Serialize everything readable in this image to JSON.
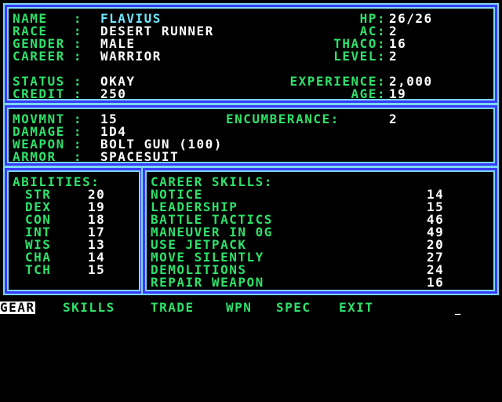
{
  "character": {
    "name_label": "NAME   :",
    "name": "FLAVIUS",
    "race_label": "RACE   :",
    "race": "DESERT RUNNER",
    "gender_label": "GENDER :",
    "gender": "MALE",
    "career_label": "CAREER :",
    "career": "WARRIOR",
    "status_label": "STATUS :",
    "status": "OKAY",
    "credit_label": "CREDIT :",
    "credit": "250",
    "hp_label": "HP:",
    "hp": "26/26",
    "ac_label": "AC:",
    "ac": "2",
    "thaco_label": "THACO:",
    "thaco": "16",
    "level_label": "LEVEL:",
    "level": "2",
    "experience_label": "EXPERIENCE:",
    "experience": "2,000",
    "age_label": "AGE:",
    "age": "19"
  },
  "equipment": {
    "movement_label": "MOVMNT :",
    "movement": "15",
    "damage_label": "DAMAGE :",
    "damage": "1D4",
    "weapon_label": "WEAPON :",
    "weapon": "BOLT GUN (100)",
    "armor_label": "ARMOR  :",
    "armor": "SPACESUIT",
    "encumberance_label": "ENCUMBERANCE:",
    "encumberance": "2"
  },
  "abilities": {
    "header": "ABILITIES:",
    "items": [
      {
        "name": "STR",
        "value": "20"
      },
      {
        "name": "DEX",
        "value": "19"
      },
      {
        "name": "CON",
        "value": "18"
      },
      {
        "name": "INT",
        "value": "17"
      },
      {
        "name": "WIS",
        "value": "13"
      },
      {
        "name": "CHA",
        "value": "14"
      },
      {
        "name": "TCH",
        "value": "15"
      }
    ]
  },
  "skills": {
    "header": "CAREER SKILLS:",
    "items": [
      {
        "name": "NOTICE",
        "value": "14"
      },
      {
        "name": "LEADERSHIP",
        "value": "15"
      },
      {
        "name": "BATTLE TACTICS",
        "value": "46"
      },
      {
        "name": "MANEUVER IN 0G",
        "value": "49"
      },
      {
        "name": "USE JETPACK",
        "value": "20"
      },
      {
        "name": "MOVE SILENTLY",
        "value": "27"
      },
      {
        "name": "DEMOLITIONS",
        "value": "24"
      },
      {
        "name": "REPAIR WEAPON",
        "value": "16"
      }
    ]
  },
  "menu": {
    "gear": "GEAR",
    "skills": "SKILLS",
    "trade": "TRADE",
    "wpn": "WPN",
    "spec": "SPEC",
    "exit": "EXIT",
    "cursor": "_"
  },
  "colors": {
    "frame": "#3a3aff",
    "frame_glow": "#7ad7f0",
    "label": "#2ee06a",
    "value": "#ffffff",
    "name": "#6fe6ff"
  }
}
